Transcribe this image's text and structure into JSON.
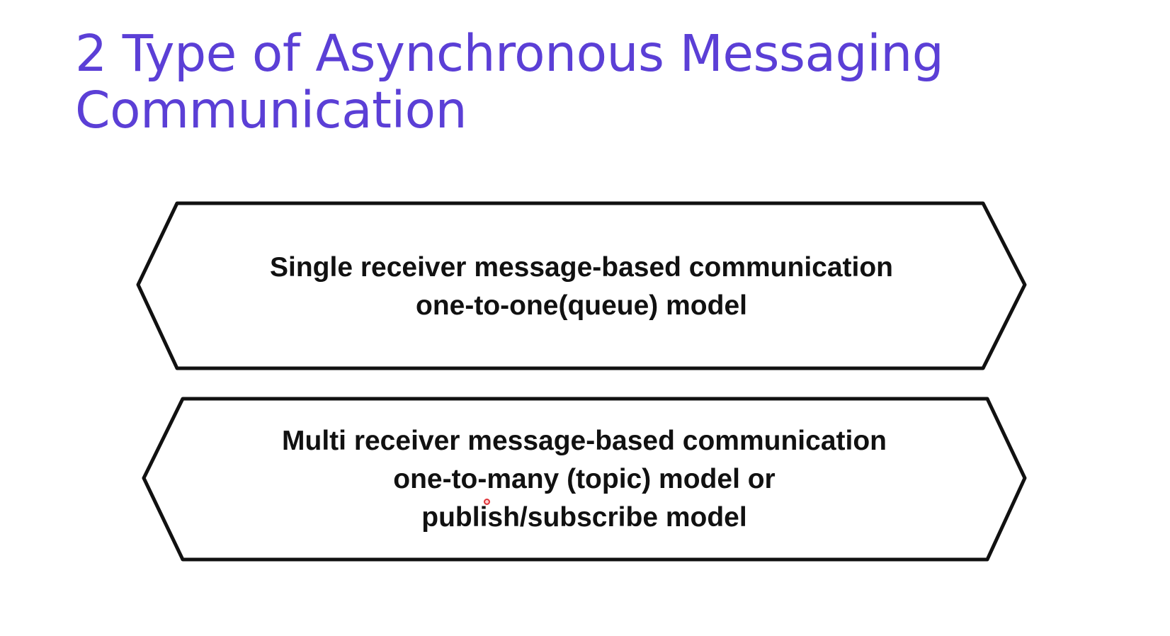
{
  "title": {
    "line1": "2 Type of Asynchronous Messaging",
    "line2": "Communication"
  },
  "shapes": [
    {
      "lines": [
        "Single receiver message-based communication",
        "one-to-one(queue) model"
      ]
    },
    {
      "lines": [
        "Multi receiver message-based communication",
        "one-to-many (topic) model or",
        "publish/subscribe model"
      ]
    }
  ],
  "colors": {
    "title": "#5b3fd6",
    "text": "#111111",
    "stroke": "#111111",
    "cursor": "#e0353a"
  }
}
